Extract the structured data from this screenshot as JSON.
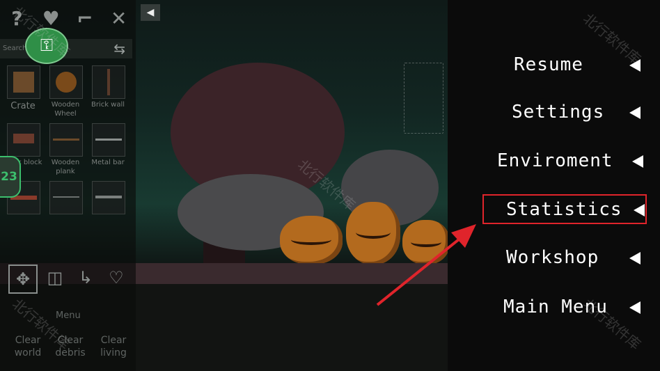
{
  "scene": {
    "pumpkins": 3
  },
  "left_panel": {
    "top_icons": [
      "question-icon",
      "heart-icon",
      "gun-icon",
      "crossed-swords-icon"
    ],
    "search_placeholder": "Search",
    "items": [
      {
        "label": "Crate",
        "color": "#6b4a2a"
      },
      {
        "label": "Wooden Wheel",
        "color": "#7a4a1a"
      },
      {
        "label": "Brick wall",
        "color": "#5a3a2a"
      },
      {
        "label": "Brick block",
        "color": "#6a3a2c"
      },
      {
        "label": "Wooden plank",
        "color": "#6b4a2a"
      },
      {
        "label": "Metal bar",
        "color": "#8a8f8d"
      },
      {
        "label": "",
        "color": "#8a3a2a"
      },
      {
        "label": "",
        "color": "#6a6f6d"
      },
      {
        "label": "",
        "color": "#7a7f7d"
      }
    ],
    "badge_count": "23",
    "tools": [
      "move-icon",
      "resize-icon",
      "hook-icon",
      "heart-hook-icon"
    ],
    "menu_label": "Menu",
    "clear_buttons": [
      {
        "line1": "Clear",
        "line2": "world"
      },
      {
        "line1": "Clear",
        "line2": "debris"
      },
      {
        "line1": "Clear",
        "line2": "living"
      }
    ]
  },
  "pause_menu": {
    "items": [
      {
        "label": "Resume"
      },
      {
        "label": "Settings"
      },
      {
        "label": "Enviroment"
      },
      {
        "label": "Statistics"
      },
      {
        "label": "Workshop"
      },
      {
        "label": "Main Menu"
      }
    ],
    "highlight_color": "#e0242b"
  },
  "watermark": "北行软件库"
}
